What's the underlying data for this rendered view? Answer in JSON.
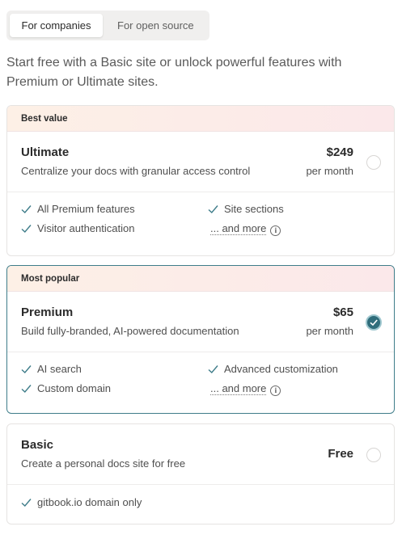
{
  "tabs": [
    {
      "label": "For companies",
      "active": true
    },
    {
      "label": "For open source",
      "active": false
    }
  ],
  "intro": "Start free with a Basic site or unlock powerful features with Premium or Ultimate sites.",
  "plans": [
    {
      "banner": "Best value",
      "name": "Ultimate",
      "description": "Centralize your docs with granular access control",
      "price": "$249",
      "period": "per month",
      "selected": false,
      "features": [
        "All Premium features",
        "Site sections",
        "Visitor authentication"
      ],
      "more": "... and more"
    },
    {
      "banner": "Most popular",
      "name": "Premium",
      "description": "Build fully-branded, AI-powered documentation",
      "price": "$65",
      "period": "per month",
      "selected": true,
      "features": [
        "AI search",
        "Advanced customization",
        "Custom domain"
      ],
      "more": "... and more"
    },
    {
      "name": "Basic",
      "description": "Create a personal docs site for free",
      "price": "Free",
      "selected": false,
      "features": [
        "gitbook.io domain only"
      ]
    }
  ],
  "colors": {
    "accent": "#2f6d7b",
    "check": "#3f7d8a",
    "banner_from": "#fdf0e6",
    "banner_to": "#fbe8ea"
  }
}
